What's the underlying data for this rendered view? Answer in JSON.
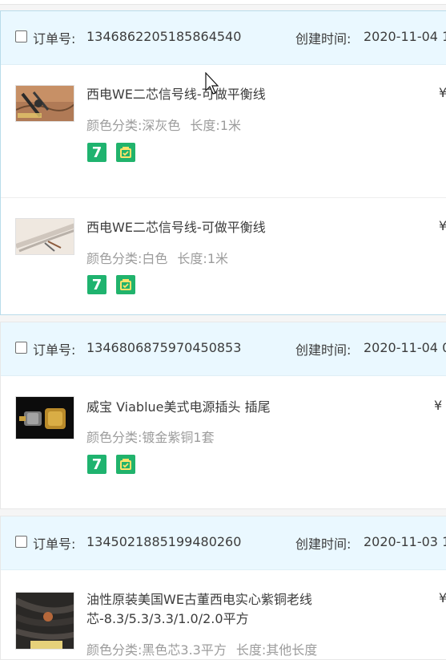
{
  "orders": [
    {
      "order_no_label": "订单号:",
      "order_no": "1346862205185864540",
      "created_label": "创建时间:",
      "created_time": "2020-11-04 1",
      "items": [
        {
          "title": "西电WE二芯信号线-可做平衡线",
          "attr1_label": "颜色分类:",
          "attr1_value": "深灰色",
          "attr2_label": "长度:",
          "attr2_value": "1米",
          "price": "¥"
        },
        {
          "title": "西电WE二芯信号线-可做平衡线",
          "attr1_label": "颜色分类:",
          "attr1_value": "白色",
          "attr2_label": "长度:",
          "attr2_value": "1米",
          "price": "¥"
        }
      ]
    },
    {
      "order_no_label": "订单号:",
      "order_no": "1346806875970450853",
      "created_label": "创建时间:",
      "created_time": "2020-11-04 0",
      "items": [
        {
          "title": "威宝 Viablue美式电源插头 插尾",
          "attr1_label": "颜色分类:",
          "attr1_value": "镀金紫铜1套",
          "price": "¥"
        }
      ]
    },
    {
      "order_no_label": "订单号:",
      "order_no": "1345021885199480260",
      "created_label": "创建时间:",
      "created_time": "2020-11-03 1",
      "items": [
        {
          "title": "油性原装美国WE古董西电实心紫铜老线芯-8.3/5.3/3.3/1.0/2.0平方",
          "attr1_label": "颜色分类:",
          "attr1_value": "黑色芯3.3平方",
          "attr2_label": "长度:",
          "attr2_value": "其他长度",
          "price": "¥"
        }
      ]
    }
  ],
  "badges": {
    "seven_day_text": "7"
  },
  "colors": {
    "header_bg": "#eaf8ff",
    "badge_green": "#1fb36f",
    "muted_text": "#9c9c9c"
  }
}
